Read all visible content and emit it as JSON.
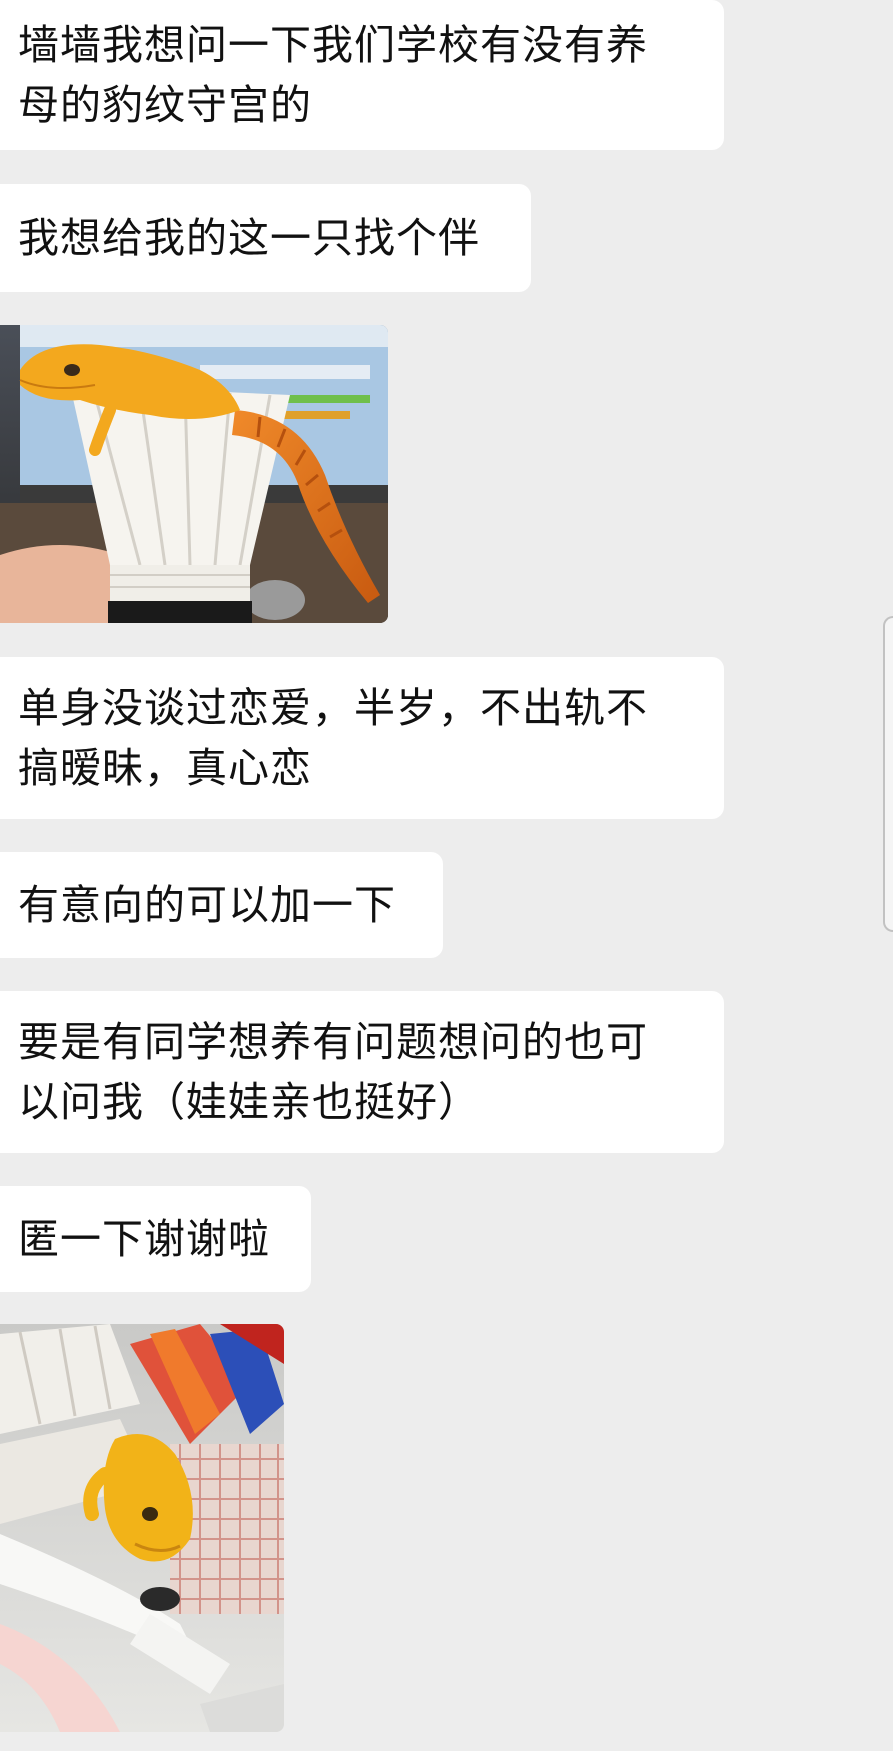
{
  "messages": [
    {
      "type": "text",
      "text": "墙墙我想问一下我们学校有没有养\n母的豹纹守宫的"
    },
    {
      "type": "text",
      "text": "我想给我的这一只找个伴"
    },
    {
      "type": "image",
      "description_icon": "gecko-on-shuttlecock-photo"
    },
    {
      "type": "text",
      "text": "单身没谈过恋爱，半岁，不出轨不\n搞暧昧，真心恋"
    },
    {
      "type": "text",
      "text": "有意向的可以加一下"
    },
    {
      "type": "text",
      "text": "要是有同学想养有问题想问的也可\n以问我（娃娃亲也挺好）"
    },
    {
      "type": "text",
      "text": "匿一下谢谢啦"
    },
    {
      "type": "image",
      "description_icon": "gecko-in-basket-photo"
    }
  ],
  "colors": {
    "background": "#ededed",
    "bubble": "#ffffff",
    "text": "#111111",
    "gecko": "#f2a21e"
  }
}
